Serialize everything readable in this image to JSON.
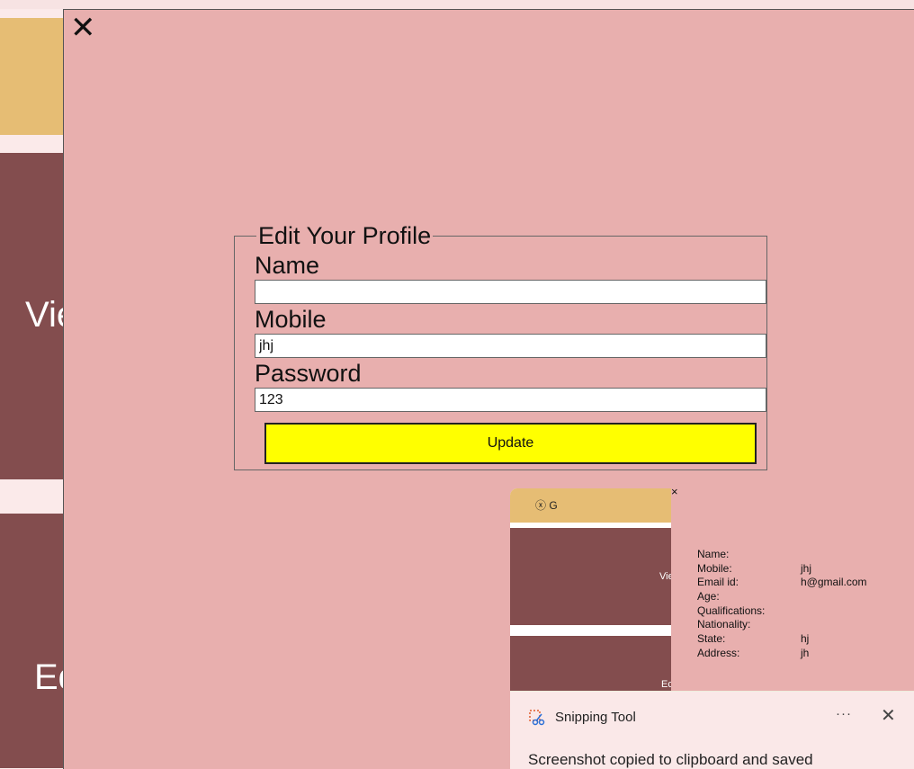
{
  "background_app": {
    "view_partial": "Vie",
    "edit_partial": "Ed"
  },
  "modal": {
    "close_glyph": "✕",
    "form": {
      "legend": "Edit Your Profile",
      "name_label": "Name",
      "name_value": "",
      "mobile_label": "Mobile",
      "mobile_value": "jhj",
      "password_label": "Password",
      "password_value": "123",
      "update_label": "Update"
    }
  },
  "thumbnail": {
    "icons": "ⓧ G",
    "view_partial": "Vie",
    "edit_partial": "Ec",
    "close_glyph": "×",
    "info": [
      {
        "key": "Name:",
        "value": ""
      },
      {
        "key": "Mobile:",
        "value": "jhj"
      },
      {
        "key": "Email id:",
        "value": "h@gmail.com"
      },
      {
        "key": "Age:",
        "value": ""
      },
      {
        "key": "Qualifications:",
        "value": ""
      },
      {
        "key": "Nationality:",
        "value": ""
      },
      {
        "key": "State:",
        "value": "hj"
      },
      {
        "key": "Address:",
        "value": "jh"
      }
    ]
  },
  "toast": {
    "app_name": "Snipping Tool",
    "more_glyph": "···",
    "close_glyph": "✕",
    "message": "Screenshot copied to clipboard and saved"
  },
  "colors": {
    "modal_bg": "#e8afae",
    "header_tan": "#e6bd74",
    "panel_brown": "#834d4e",
    "update_button": "#ffff00"
  }
}
